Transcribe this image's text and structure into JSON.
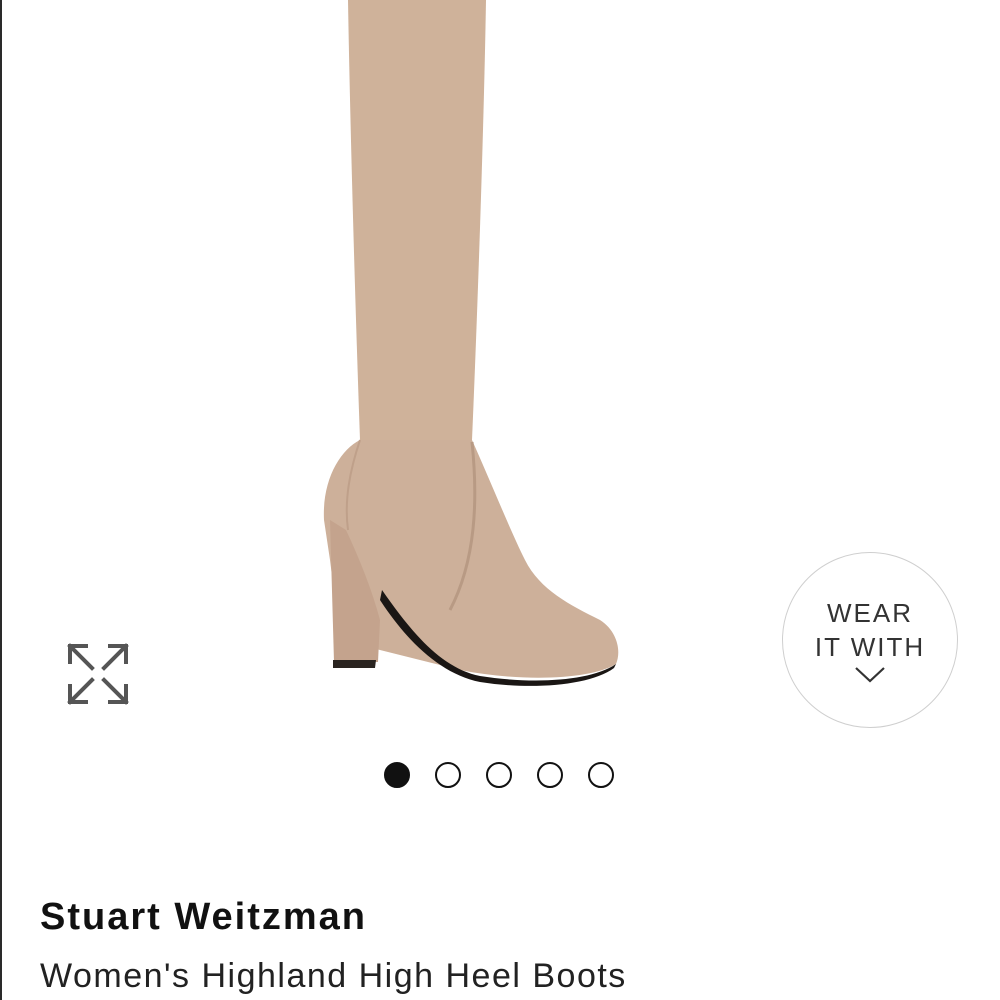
{
  "product": {
    "brand": "Stuart Weitzman",
    "name": "Women's Highland High Heel Boots",
    "image_alt": "Women's Highland High Heel Boots in taupe suede",
    "color": "#cfb29a"
  },
  "gallery": {
    "expand_icon": "expand-arrows-icon",
    "dots": [
      {
        "active": true
      },
      {
        "active": false
      },
      {
        "active": false
      },
      {
        "active": false
      },
      {
        "active": false
      }
    ]
  },
  "wear_it_with": {
    "line1": "WEAR",
    "line2": "IT WITH",
    "icon": "chevron-down-icon"
  }
}
